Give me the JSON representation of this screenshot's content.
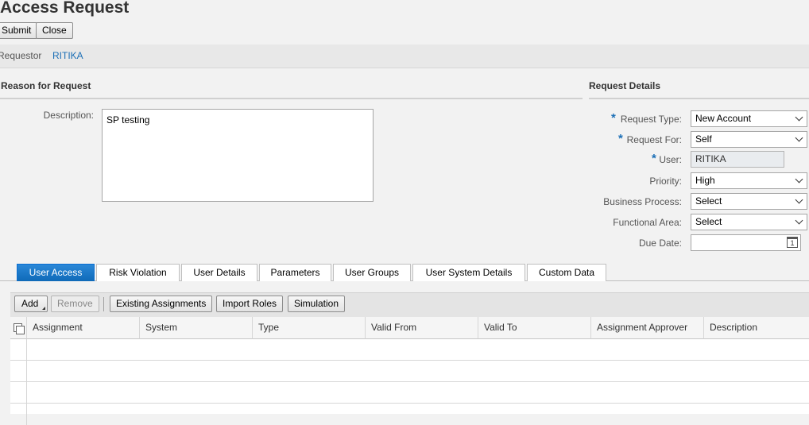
{
  "page": {
    "title": "Access Request"
  },
  "toolbar": {
    "submit": "Submit",
    "close": "Close"
  },
  "requestor": {
    "label": "Requestor",
    "value": "RITIKA"
  },
  "reason": {
    "heading": "Reason for Request",
    "description_label": "Description:",
    "description_value": "SP testing"
  },
  "details": {
    "heading": "Request Details",
    "request_type": {
      "label": "Request Type:",
      "value": "New Account"
    },
    "request_for": {
      "label": "Request For:",
      "value": "Self"
    },
    "user": {
      "label": "User:",
      "value": "RITIKA"
    },
    "priority": {
      "label": "Priority:",
      "value": "High"
    },
    "business_process": {
      "label": "Business Process:",
      "value": "Select"
    },
    "functional_area": {
      "label": "Functional Area:",
      "value": "Select"
    },
    "due_date": {
      "label": "Due Date:",
      "value": "",
      "calendar_day": "1"
    },
    "required_marker": "*"
  },
  "tabs": [
    "User Access",
    "Risk Violation",
    "User Details",
    "Parameters",
    "User Groups",
    "User System Details",
    "Custom Data"
  ],
  "grid_toolbar": {
    "add": "Add",
    "remove": "Remove",
    "existing": "Existing Assignments",
    "import": "Import Roles",
    "simulation": "Simulation"
  },
  "table": {
    "columns": [
      "Assignment",
      "System",
      "Type",
      "Valid From",
      "Valid To",
      "Assignment Approver",
      "Description"
    ],
    "rows": []
  },
  "colors": {
    "accent": "#0a6ed1",
    "link": "#1c6fb6"
  }
}
